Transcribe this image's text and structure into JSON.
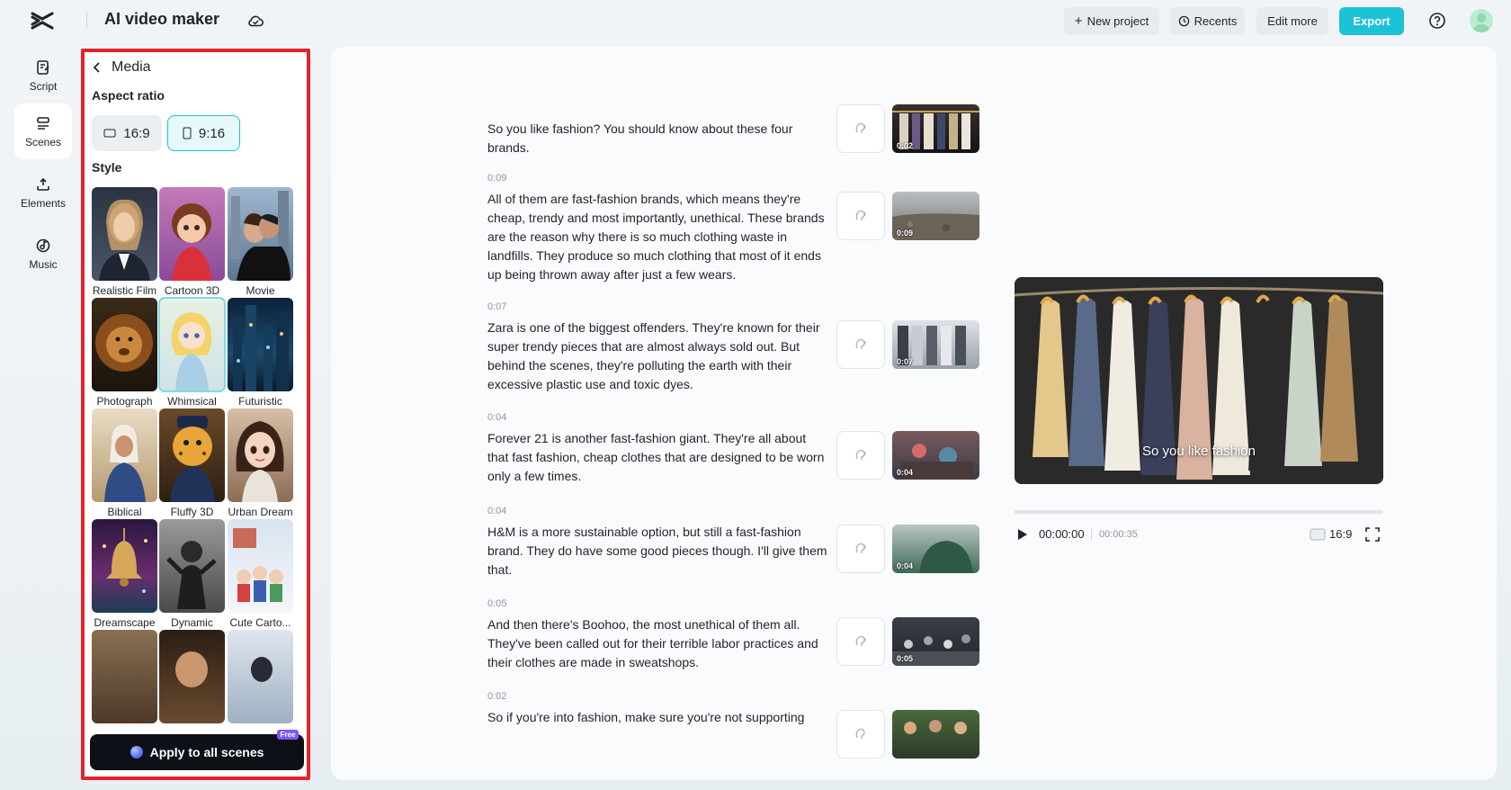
{
  "header": {
    "app_title": "AI video maker",
    "buttons": {
      "new_project": "New project",
      "recents": "Recents",
      "edit_more": "Edit more",
      "export": "Export"
    },
    "icons": [
      "capcut-logo-icon",
      "cloud-icon",
      "help-icon",
      "avatar"
    ]
  },
  "rail": {
    "items": [
      {
        "label": "Script",
        "icon": "script-icon",
        "active": false
      },
      {
        "label": "Scenes",
        "icon": "scenes-icon",
        "active": true
      },
      {
        "label": "Elements",
        "icon": "elements-icon",
        "active": false
      },
      {
        "label": "Music",
        "icon": "music-icon",
        "active": false
      }
    ]
  },
  "media_panel": {
    "title": "Media",
    "aspect_ratio_label": "Aspect ratio",
    "ratios": [
      {
        "label": "16:9",
        "selected": false
      },
      {
        "label": "9:16",
        "selected": true
      }
    ],
    "style_label": "Style",
    "styles": [
      {
        "name": "Realistic Film",
        "selected": false
      },
      {
        "name": "Cartoon 3D",
        "selected": false
      },
      {
        "name": "Movie",
        "selected": false
      },
      {
        "name": "Photograph",
        "selected": false
      },
      {
        "name": "Whimsical",
        "selected": true
      },
      {
        "name": "Futuristic",
        "selected": false
      },
      {
        "name": "Biblical",
        "selected": false
      },
      {
        "name": "Fluffy 3D",
        "selected": false
      },
      {
        "name": "Urban Dream",
        "selected": false
      },
      {
        "name": "Dreamscape",
        "selected": false
      },
      {
        "name": "Dynamic",
        "selected": false
      },
      {
        "name": "Cute Carto...",
        "selected": false
      },
      {
        "name": "",
        "selected": false
      },
      {
        "name": "",
        "selected": false
      },
      {
        "name": "",
        "selected": false
      }
    ],
    "apply_button": "Apply to all scenes",
    "free_badge": "Free"
  },
  "scenes": [
    {
      "time": "",
      "text": "So you like fashion? You should know about these four brands.",
      "thumb_duration": "0:02"
    },
    {
      "time": "0:09",
      "text": "All of them are fast-fashion brands, which means they're cheap, trendy and most importantly, unethical. These brands are the reason why there is so much clothing waste in landfills. They produce so much clothing that most of it ends up being thrown away after just a few wears.",
      "thumb_duration": "0:09"
    },
    {
      "time": "0:07",
      "text": "Zara is one of the biggest offenders. They're known for their super trendy pieces that are almost always sold out. But behind the scenes, they're polluting the earth with their excessive plastic use and toxic dyes.",
      "thumb_duration": "0:07"
    },
    {
      "time": "0:04",
      "text": "Forever 21 is another fast-fashion giant. They're all about that fast fashion, cheap clothes that are designed to be worn only a few times.",
      "thumb_duration": "0:04"
    },
    {
      "time": "0:04",
      "text": "H&M is a more sustainable option, but still a fast-fashion brand. They do have some good pieces though. I'll give them that.",
      "thumb_duration": "0:04"
    },
    {
      "time": "0:05",
      "text": "And then there's Boohoo, the most unethical of them all. They've been called out for their terrible labor practices and their clothes are made in sweatshops.",
      "thumb_duration": "0:05"
    },
    {
      "time": "0:02",
      "text": "So if you're into fashion, make sure you're not supporting",
      "thumb_duration": ""
    }
  ],
  "preview": {
    "caption": "So you like fashion",
    "current_time": "00:00:00",
    "total_time": "00:00:35",
    "ratio": "16:9",
    "progress": 0
  },
  "colors": {
    "accent": "#1cc2d6",
    "panel_highlight": "#e5232a",
    "apply_button": "#0d1117",
    "free_badge": "#7b56ff"
  }
}
